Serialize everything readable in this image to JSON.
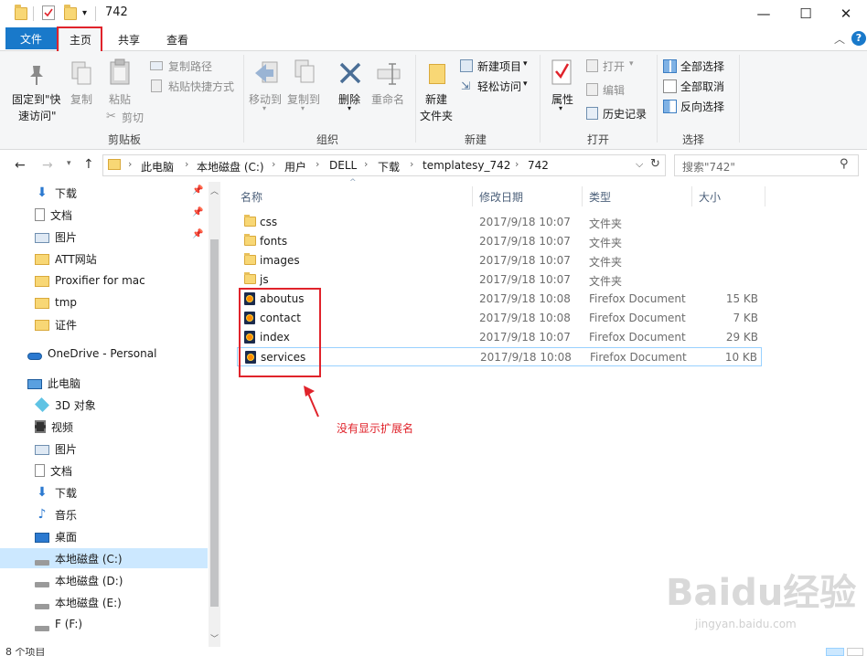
{
  "window": {
    "title": "742",
    "minimize": "—",
    "maximize": "☐",
    "close": "✕"
  },
  "menu": {
    "file": "文件",
    "home": "主页",
    "share": "共享",
    "view": "查看"
  },
  "ribbon": {
    "pin_quick_access": [
      "固定到\"快",
      "速访问\""
    ],
    "copy": "复制",
    "paste": "粘贴",
    "copy_path": "复制路径",
    "paste_shortcut": "粘贴快捷方式",
    "cut": "剪切",
    "clipboard_group": "剪贴板",
    "move_to": "移动到",
    "copy_to": "复制到",
    "delete": "删除",
    "rename": "重命名",
    "organize_group": "组织",
    "new_item": "新建项目",
    "easy_access": "轻松访问",
    "new_folder": [
      "新建",
      "文件夹"
    ],
    "new_group": "新建",
    "properties": "属性",
    "open": "打开",
    "edit": "编辑",
    "history": "历史记录",
    "open_group": "打开",
    "select_all": "全部选择",
    "select_none": "全部取消",
    "invert_selection": "反向选择",
    "select_group": "选择"
  },
  "address": {
    "crumbs": [
      "此电脑",
      "本地磁盘 (C:)",
      "用户",
      "DELL",
      "下载",
      "templatesy_742",
      "742"
    ],
    "search_placeholder": "搜索\"742\""
  },
  "nav": {
    "quick": [
      {
        "label": "下载",
        "icon": "download-arrow-icon",
        "pinned": true
      },
      {
        "label": "文档",
        "icon": "document-icon",
        "pinned": true
      },
      {
        "label": "图片",
        "icon": "picture-icon",
        "pinned": true
      },
      {
        "label": "ATT网站",
        "icon": "folder-icon"
      },
      {
        "label": "Proxifier for mac",
        "icon": "folder-icon"
      },
      {
        "label": "tmp",
        "icon": "folder-icon"
      },
      {
        "label": "证件",
        "icon": "folder-icon"
      }
    ],
    "onedrive": "OneDrive - Personal",
    "thispc": "此电脑",
    "pc_items": [
      {
        "label": "3D 对象",
        "icon": "3d-objects-icon"
      },
      {
        "label": "视频",
        "icon": "video-icon"
      },
      {
        "label": "图片",
        "icon": "picture-icon"
      },
      {
        "label": "文档",
        "icon": "document-icon"
      },
      {
        "label": "下载",
        "icon": "download-arrow-icon"
      },
      {
        "label": "音乐",
        "icon": "music-icon"
      },
      {
        "label": "桌面",
        "icon": "desktop-icon"
      },
      {
        "label": "本地磁盘 (C:)",
        "icon": "drive-icon",
        "selected": true
      },
      {
        "label": "本地磁盘 (D:)",
        "icon": "drive-icon"
      },
      {
        "label": "本地磁盘 (E:)",
        "icon": "drive-icon"
      },
      {
        "label": "F (F:)",
        "icon": "drive-icon"
      }
    ]
  },
  "columns": {
    "name": "名称",
    "date": "修改日期",
    "type": "类型",
    "size": "大小"
  },
  "files": [
    {
      "name": "css",
      "date": "2017/9/18 10:07",
      "type": "文件夹",
      "size": "",
      "kind": "folder"
    },
    {
      "name": "fonts",
      "date": "2017/9/18 10:07",
      "type": "文件夹",
      "size": "",
      "kind": "folder"
    },
    {
      "name": "images",
      "date": "2017/9/18 10:07",
      "type": "文件夹",
      "size": "",
      "kind": "folder"
    },
    {
      "name": "js",
      "date": "2017/9/18 10:07",
      "type": "文件夹",
      "size": "",
      "kind": "folder"
    },
    {
      "name": "aboutus",
      "date": "2017/9/18 10:08",
      "type": "Firefox Document",
      "size": "15 KB",
      "kind": "html"
    },
    {
      "name": "contact",
      "date": "2017/9/18 10:08",
      "type": "Firefox Document",
      "size": "7 KB",
      "kind": "html"
    },
    {
      "name": "index",
      "date": "2017/9/18 10:07",
      "type": "Firefox Document",
      "size": "29 KB",
      "kind": "html"
    },
    {
      "name": "services",
      "date": "2017/9/18 10:08",
      "type": "Firefox Document",
      "size": "10 KB",
      "kind": "html"
    }
  ],
  "annotation": "没有显示扩展名",
  "status": "8 个项目",
  "watermark": {
    "logo": "Baidu经验",
    "url": "jingyan.baidu.com"
  },
  "colors": {
    "accent": "#1979ca",
    "highlight_box": "#e0232b",
    "selection": "#cce8ff"
  }
}
